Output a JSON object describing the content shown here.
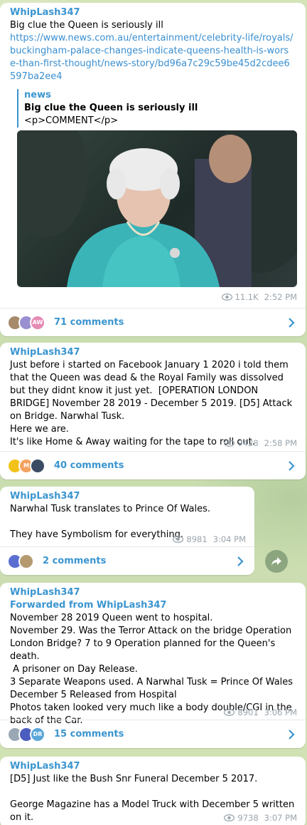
{
  "posts": [
    {
      "author": "WhipLash347",
      "text": "Big clue the Queen is seriously ill",
      "link": "https://www.news.com.au/entertainment/celebrity-life/royals/buckingham-palace-changes-indicate-queens-health-is-worse-than-first-thought/news-story/bd96a7c29c59be45d2cdee6597ba2ee4",
      "preview": {
        "site": "news",
        "title": "Big clue the Queen is seriously ill",
        "body": "<p>COMMENT</p>"
      },
      "views": "11.1K",
      "time": "2:52 PM",
      "comments": "71 comments",
      "avatars": [
        {
          "label": "",
          "color": "#a68a6a"
        },
        {
          "label": "",
          "color": "#9a8fd0"
        },
        {
          "label": "AW",
          "color": "#e58bb4"
        }
      ]
    },
    {
      "author": "WhipLash347",
      "text": "Just before i started on Facebook January 1 2020 i told them that the Queen was dead & the Royal Family was dissolved but they didnt know it just yet.  [OPERATION LONDON BRIDGE] November 28 2019 - December 5 2019. [D5] Attack on Bridge. Narwhal Tusk.\nHere we are.\nIt's like Home & Away waiting for the tape to roll out.",
      "views": "9428",
      "time": "2:58 PM",
      "comments": "40 comments",
      "avatars": [
        {
          "label": "",
          "color": "#f3c21a"
        },
        {
          "label": "M",
          "color": "#f4a261"
        },
        {
          "label": "",
          "color": "#3b4b63"
        }
      ]
    },
    {
      "author": "WhipLash347",
      "text": "Narwhal Tusk translates to Prince Of Wales.\n\nThey have Symbolism for everything.",
      "views": "8981",
      "time": "3:04 PM",
      "comments": "2 comments",
      "avatars": [
        {
          "label": "",
          "color": "#5a6fd0"
        },
        {
          "label": "",
          "color": "#b59a70"
        }
      ]
    },
    {
      "author": "WhipLash347",
      "forwarded": "Forwarded from WhipLash347",
      "text": "November 28 2019 Queen went to hospital.\nNovember 29. Was the Terror Attack on the bridge Operation London Bridge? 7 to 9 Operation planned for the Queen's death.\n A prisoner on Day Release.\n3 Separate Weapons used. A Narwhal Tusk = Prince Of Wales\nDecember 5 Released from Hospital\nPhotos taken looked very much like a body double/CGI in the back of the Car.",
      "views": "8901",
      "time": "3:06 PM",
      "comments": "15 comments",
      "avatars": [
        {
          "label": "",
          "color": "#9aa8b5"
        },
        {
          "label": "",
          "color": "#4b5dbf"
        },
        {
          "label": "DR",
          "color": "#5aa6d8"
        }
      ]
    },
    {
      "author": "WhipLash347",
      "text": "[D5] Just like the Bush Snr Funeral December 5 2017.\n\nGeorge Magazine has a Model Truck with December 5 written on it.",
      "views": "9738",
      "time": "3:07 PM"
    }
  ],
  "icons": {
    "views": "eye-icon",
    "chevron": "chevron-right-icon",
    "share": "share-arrow-icon"
  }
}
